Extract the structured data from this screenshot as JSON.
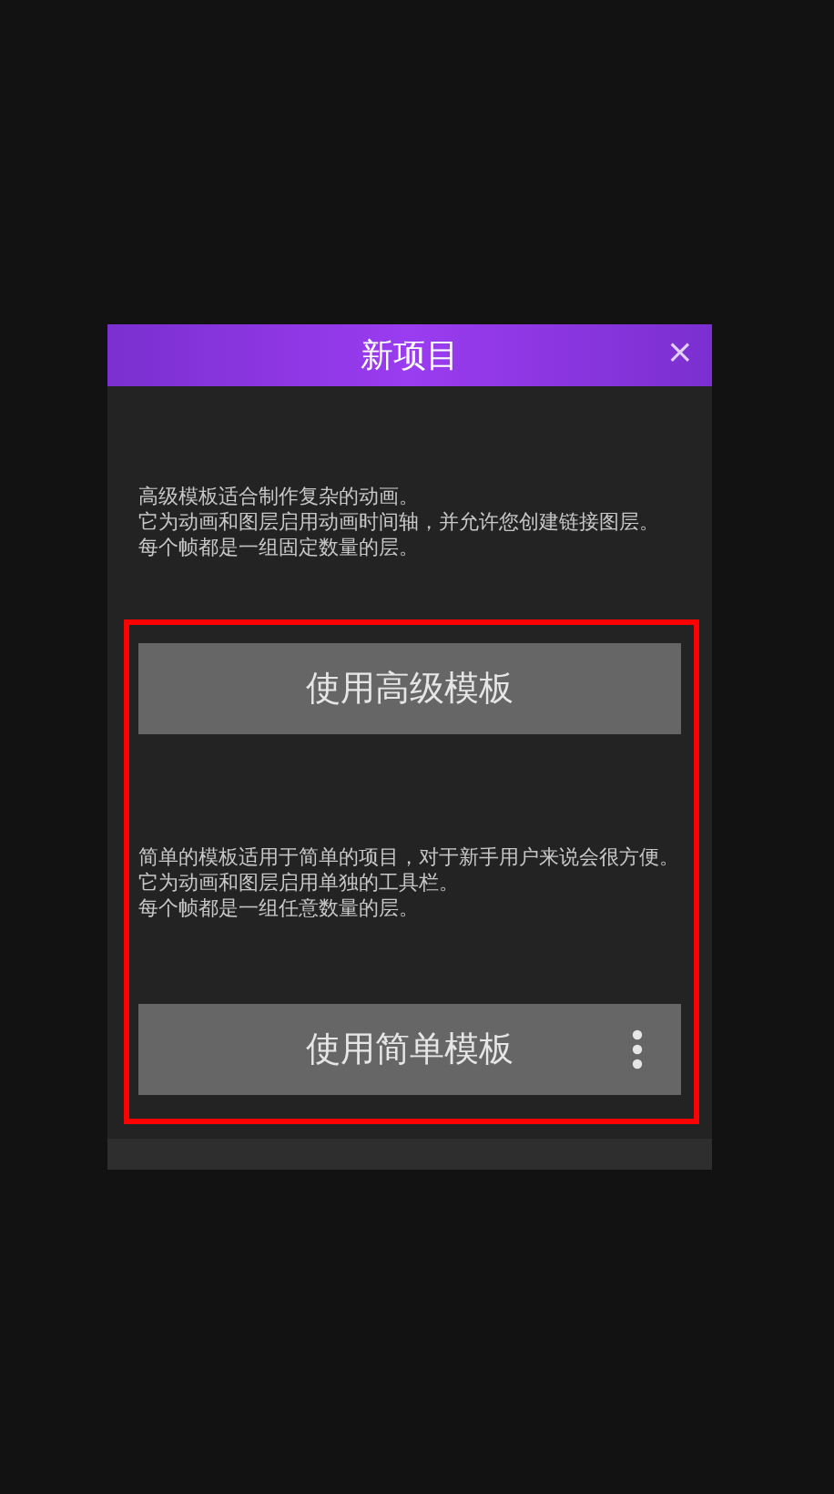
{
  "dialog": {
    "title": "新项目",
    "close": "×"
  },
  "options": [
    {
      "lines": [
        "高级模板适合制作复杂的动画。",
        "它为动画和图层启用动画时间轴，并允许您创建链接图层。",
        "每个帧都是一组固定数量的层。"
      ],
      "button": "使用高级模板",
      "has_menu": false
    },
    {
      "lines": [
        "简单的模板适用于简单的项目，对于新手用户来说会很方便。",
        "它为动画和图层启用单独的工具栏。",
        "每个帧都是一组任意数量的层。"
      ],
      "button": "使用简单模板",
      "has_menu": true
    }
  ],
  "highlight": true
}
